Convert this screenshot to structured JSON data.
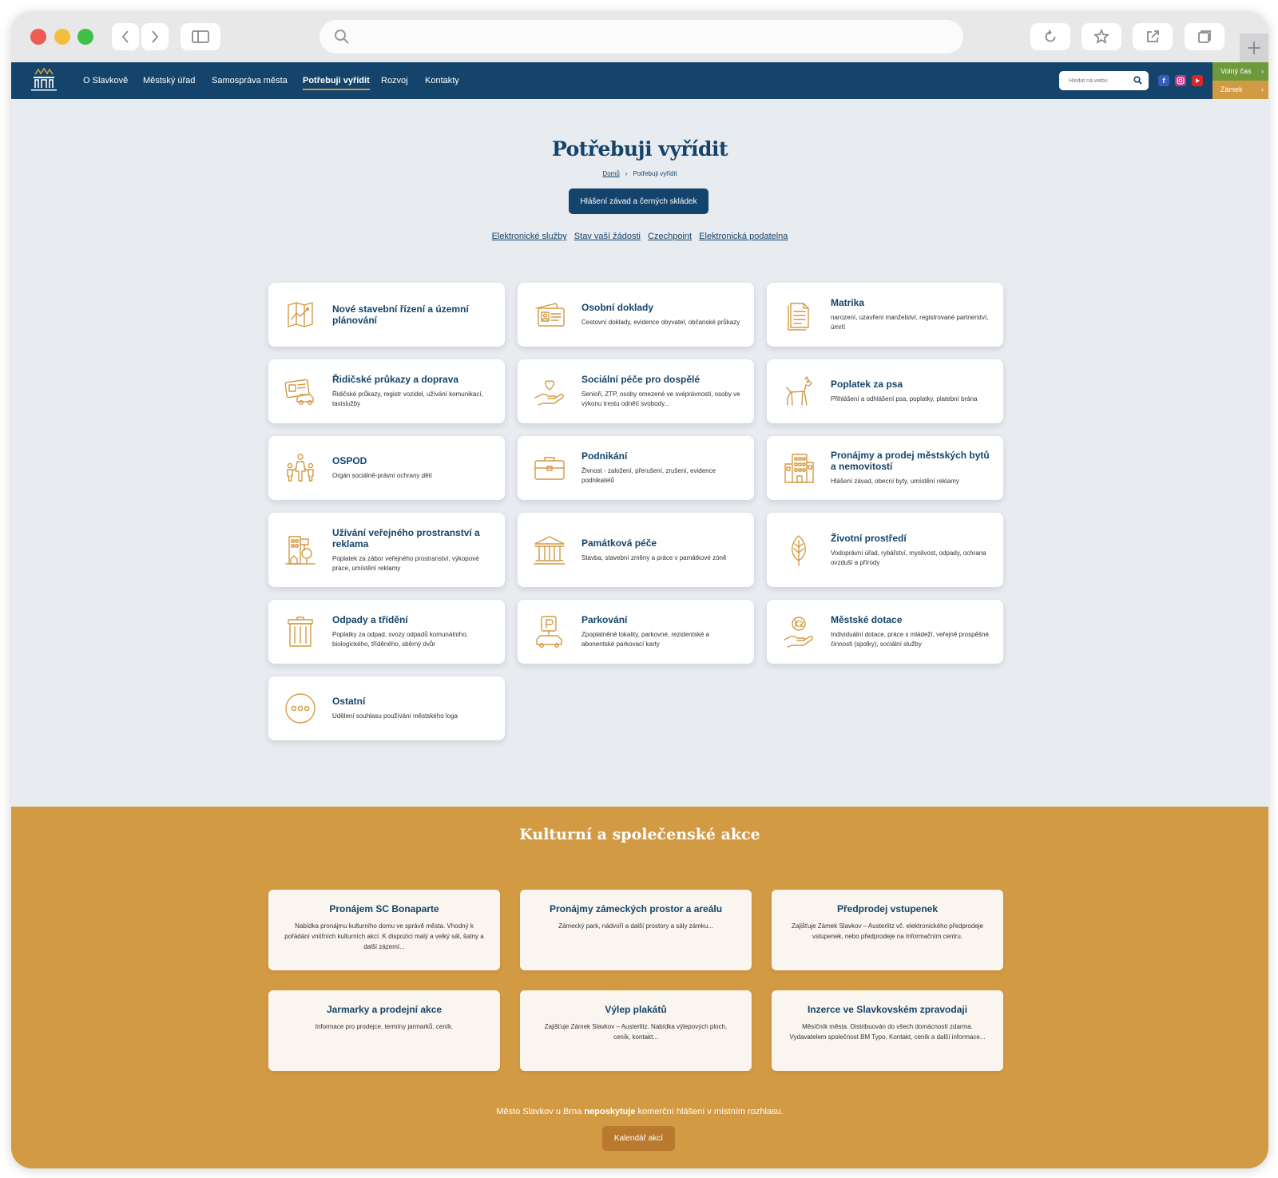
{
  "nav": {
    "items": [
      "O Slavkově",
      "Městský úřad",
      "Samospráva města",
      "Potřebuji vyřídit",
      "Rozvoj",
      "Kontakty"
    ],
    "search_placeholder": "Hledat na webu",
    "side_tabs": [
      "Volný čas",
      "Zámek"
    ],
    "colors": {
      "primary": "#14446b",
      "accent": "#d39a44",
      "volny_cas": "#6f9a3c",
      "zamek": "#d39a44"
    }
  },
  "page": {
    "title": "Potřebuji vyřídit",
    "breadcrumb_home": "Domů",
    "breadcrumb_sep": "›",
    "breadcrumb_current": "Potřebuji vyřídit",
    "cta": "Hlášení závad a černých skládek",
    "quicklinks": [
      "Elektronické služby",
      "Stav vaší žádosti",
      "Czechpoint",
      "Elektronická podatelna"
    ]
  },
  "services": [
    {
      "title": "Nové stavební řízení a územní plánování",
      "desc": "",
      "icon": "map-icon"
    },
    {
      "title": "Osobní doklady",
      "desc": "Cestovní doklady, evidence obyvatel, občanské průkazy",
      "icon": "id-card-icon"
    },
    {
      "title": "Matrika",
      "desc": "narození, uzavření manželství, registrované partnerství, úmrtí",
      "icon": "documents-icon"
    },
    {
      "title": "Řidičské průkazy a doprava",
      "desc": "Řidičské průkazy, registr vozidel, užívání komunikací, taxislužby",
      "icon": "driver-license-icon"
    },
    {
      "title": "Sociální péče pro dospělé",
      "desc": "Senioři, ZTP, osoby omezené ve svéprávnosti, osoby ve výkonu trestu odnětí svobody...",
      "icon": "heart-hand-icon"
    },
    {
      "title": "Poplatek za psa",
      "desc": "Přihlášení a odhlášení psa, poplatky, platební brána",
      "icon": "dog-icon"
    },
    {
      "title": "OSPOD",
      "desc": "Orgán sociálně-právní ochrany dětí",
      "icon": "family-icon"
    },
    {
      "title": "Podnikání",
      "desc": "Živnost - založení, přerušení, zrušení, evidence podnikatelů",
      "icon": "briefcase-icon"
    },
    {
      "title": "Pronájmy a prodej městských bytů a nemovitostí",
      "desc": "Hlášení závad, obecní byty, umístění reklamy",
      "icon": "building-icon"
    },
    {
      "title": "Užívání veřejného prostranství a reklama",
      "desc": "Poplatek za zábor veřejného prostranství, výkopové práce, umístění reklamy",
      "icon": "public-space-icon"
    },
    {
      "title": "Památková péče",
      "desc": "Stavba, stavební změny a práce v památkové zóně",
      "icon": "monument-icon"
    },
    {
      "title": "Životní prostředí",
      "desc": "Vodoprávní úřad, rybářství, myslivost, odpady, ochrana ovzduší a přírody",
      "icon": "leaf-icon"
    },
    {
      "title": "Odpady a třídění",
      "desc": "Poplatky za odpad, svozy odpadů komunálního, biologického, tříděného, sběrný dvůr",
      "icon": "trash-bin-icon"
    },
    {
      "title": "Parkování",
      "desc": "Zpoplatněné lokality, parkovné, rezidentské a abonentské parkovací karty",
      "icon": "parking-icon"
    },
    {
      "title": "Městské dotace",
      "desc": "Individuální dotace, práce s mládeží, veřejně prospěšné činnosti (spolky), sociální služby",
      "icon": "grant-hand-icon"
    },
    {
      "title": "Ostatní",
      "desc": "Udělení souhlasu používání městského loga",
      "icon": "more-icon"
    }
  ],
  "events": {
    "title": "Kulturní a společenské akce",
    "cards": [
      {
        "title": "Pronájem SC Bonaparte",
        "desc": "Nabídka pronájmu kulturního domu ve správě města. Vhodný k pořádání vnitřních kulturních akcí. K dispozici malý a velký sál, šatny a další zázemí..."
      },
      {
        "title": "Pronájmy zámeckých prostor a areálu",
        "desc": "Zámecký park, nádvoří a další prostory a sály zámku..."
      },
      {
        "title": "Předprodej vstupenek",
        "desc": "Zajišťuje Zámek Slavkov – Austerlitz vč. elektronického předprodeje vstupenek, nebo předprodeje na Informačním centru."
      },
      {
        "title": "Jarmarky a prodejní akce",
        "desc": "Informace pro prodejce, termíny jarmarků, ceník."
      },
      {
        "title": "Výlep plakátů",
        "desc": "Zajišťuje Zámek Slavkov – Austerlitz. Nabídka výlepových ploch, ceník, kontakt..."
      },
      {
        "title": "Inzerce ve Slavkovském zpravodaji",
        "desc": "Měsíčník města. Distribuován do všech domácností zdarma. Vydavatelem společnost BM Typo. Kontakt, ceník a další informace..."
      }
    ],
    "notice_before": "Město Slavkov u Brna ",
    "notice_bold": "neposkytuje",
    "notice_after": " komerční hlášení v místním rozhlasu.",
    "calendar_button": "Kalendář akcí"
  }
}
